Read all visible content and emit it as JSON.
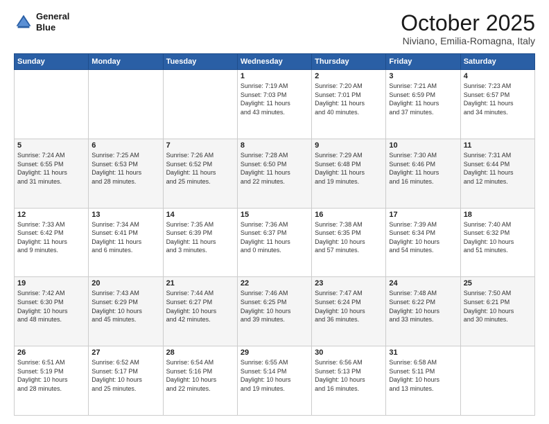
{
  "logo": {
    "line1": "General",
    "line2": "Blue"
  },
  "title": "October 2025",
  "subtitle": "Niviano, Emilia-Romagna, Italy",
  "days_of_week": [
    "Sunday",
    "Monday",
    "Tuesday",
    "Wednesday",
    "Thursday",
    "Friday",
    "Saturday"
  ],
  "weeks": [
    [
      {
        "day": "",
        "info": ""
      },
      {
        "day": "",
        "info": ""
      },
      {
        "day": "",
        "info": ""
      },
      {
        "day": "1",
        "info": "Sunrise: 7:19 AM\nSunset: 7:03 PM\nDaylight: 11 hours\nand 43 minutes."
      },
      {
        "day": "2",
        "info": "Sunrise: 7:20 AM\nSunset: 7:01 PM\nDaylight: 11 hours\nand 40 minutes."
      },
      {
        "day": "3",
        "info": "Sunrise: 7:21 AM\nSunset: 6:59 PM\nDaylight: 11 hours\nand 37 minutes."
      },
      {
        "day": "4",
        "info": "Sunrise: 7:23 AM\nSunset: 6:57 PM\nDaylight: 11 hours\nand 34 minutes."
      }
    ],
    [
      {
        "day": "5",
        "info": "Sunrise: 7:24 AM\nSunset: 6:55 PM\nDaylight: 11 hours\nand 31 minutes."
      },
      {
        "day": "6",
        "info": "Sunrise: 7:25 AM\nSunset: 6:53 PM\nDaylight: 11 hours\nand 28 minutes."
      },
      {
        "day": "7",
        "info": "Sunrise: 7:26 AM\nSunset: 6:52 PM\nDaylight: 11 hours\nand 25 minutes."
      },
      {
        "day": "8",
        "info": "Sunrise: 7:28 AM\nSunset: 6:50 PM\nDaylight: 11 hours\nand 22 minutes."
      },
      {
        "day": "9",
        "info": "Sunrise: 7:29 AM\nSunset: 6:48 PM\nDaylight: 11 hours\nand 19 minutes."
      },
      {
        "day": "10",
        "info": "Sunrise: 7:30 AM\nSunset: 6:46 PM\nDaylight: 11 hours\nand 16 minutes."
      },
      {
        "day": "11",
        "info": "Sunrise: 7:31 AM\nSunset: 6:44 PM\nDaylight: 11 hours\nand 12 minutes."
      }
    ],
    [
      {
        "day": "12",
        "info": "Sunrise: 7:33 AM\nSunset: 6:42 PM\nDaylight: 11 hours\nand 9 minutes."
      },
      {
        "day": "13",
        "info": "Sunrise: 7:34 AM\nSunset: 6:41 PM\nDaylight: 11 hours\nand 6 minutes."
      },
      {
        "day": "14",
        "info": "Sunrise: 7:35 AM\nSunset: 6:39 PM\nDaylight: 11 hours\nand 3 minutes."
      },
      {
        "day": "15",
        "info": "Sunrise: 7:36 AM\nSunset: 6:37 PM\nDaylight: 11 hours\nand 0 minutes."
      },
      {
        "day": "16",
        "info": "Sunrise: 7:38 AM\nSunset: 6:35 PM\nDaylight: 10 hours\nand 57 minutes."
      },
      {
        "day": "17",
        "info": "Sunrise: 7:39 AM\nSunset: 6:34 PM\nDaylight: 10 hours\nand 54 minutes."
      },
      {
        "day": "18",
        "info": "Sunrise: 7:40 AM\nSunset: 6:32 PM\nDaylight: 10 hours\nand 51 minutes."
      }
    ],
    [
      {
        "day": "19",
        "info": "Sunrise: 7:42 AM\nSunset: 6:30 PM\nDaylight: 10 hours\nand 48 minutes."
      },
      {
        "day": "20",
        "info": "Sunrise: 7:43 AM\nSunset: 6:29 PM\nDaylight: 10 hours\nand 45 minutes."
      },
      {
        "day": "21",
        "info": "Sunrise: 7:44 AM\nSunset: 6:27 PM\nDaylight: 10 hours\nand 42 minutes."
      },
      {
        "day": "22",
        "info": "Sunrise: 7:46 AM\nSunset: 6:25 PM\nDaylight: 10 hours\nand 39 minutes."
      },
      {
        "day": "23",
        "info": "Sunrise: 7:47 AM\nSunset: 6:24 PM\nDaylight: 10 hours\nand 36 minutes."
      },
      {
        "day": "24",
        "info": "Sunrise: 7:48 AM\nSunset: 6:22 PM\nDaylight: 10 hours\nand 33 minutes."
      },
      {
        "day": "25",
        "info": "Sunrise: 7:50 AM\nSunset: 6:21 PM\nDaylight: 10 hours\nand 30 minutes."
      }
    ],
    [
      {
        "day": "26",
        "info": "Sunrise: 6:51 AM\nSunset: 5:19 PM\nDaylight: 10 hours\nand 28 minutes."
      },
      {
        "day": "27",
        "info": "Sunrise: 6:52 AM\nSunset: 5:17 PM\nDaylight: 10 hours\nand 25 minutes."
      },
      {
        "day": "28",
        "info": "Sunrise: 6:54 AM\nSunset: 5:16 PM\nDaylight: 10 hours\nand 22 minutes."
      },
      {
        "day": "29",
        "info": "Sunrise: 6:55 AM\nSunset: 5:14 PM\nDaylight: 10 hours\nand 19 minutes."
      },
      {
        "day": "30",
        "info": "Sunrise: 6:56 AM\nSunset: 5:13 PM\nDaylight: 10 hours\nand 16 minutes."
      },
      {
        "day": "31",
        "info": "Sunrise: 6:58 AM\nSunset: 5:11 PM\nDaylight: 10 hours\nand 13 minutes."
      },
      {
        "day": "",
        "info": ""
      }
    ]
  ]
}
